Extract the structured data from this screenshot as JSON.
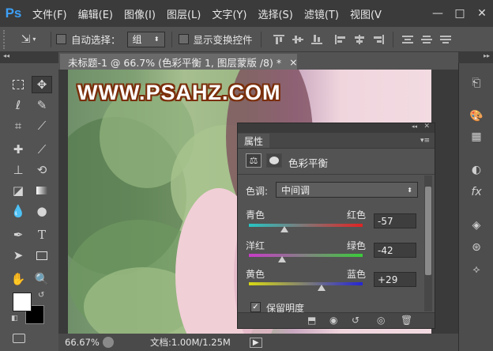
{
  "app": {
    "logo": "Ps"
  },
  "menu": [
    "文件(F)",
    "编辑(E)",
    "图像(I)",
    "图层(L)",
    "文字(Y)",
    "选择(S)",
    "滤镜(T)",
    "视图(V"
  ],
  "window_controls": {
    "minimize": "—",
    "maximize": "□",
    "close": "✕"
  },
  "options": {
    "auto_select_label": "自动选择：",
    "auto_select_value": "组",
    "show_transform_label": "显示变换控件"
  },
  "document": {
    "tab_title": "未标题-1 @ 66.7% (色彩平衡 1, 图层蒙版 /8) *",
    "close": "×",
    "watermark": "WWW.PSAHZ.COM"
  },
  "status": {
    "zoom": "66.67%",
    "doc_info": "文档:1.00M/1.25M"
  },
  "properties": {
    "tab_label": "属性",
    "panel_title": "色彩平衡",
    "tone_label": "色调:",
    "tone_value": "中间调",
    "sliders": [
      {
        "left": "青色",
        "right": "红色",
        "value": "-57",
        "position": 0.31,
        "colors": [
          "#27c4c4",
          "#e02323"
        ]
      },
      {
        "left": "洋红",
        "right": "绿色",
        "value": "-42",
        "position": 0.29,
        "colors": [
          "#c83cc8",
          "#3acb3a"
        ]
      },
      {
        "left": "黄色",
        "right": "蓝色",
        "value": "+29",
        "position": 0.64,
        "colors": [
          "#d8d814",
          "#2525d6"
        ]
      }
    ],
    "preserve_label": "保留明度",
    "preserve_checked": true
  },
  "colors": {
    "foreground": "#ffffff",
    "background": "#000000",
    "accent": "#3d9ff5"
  }
}
